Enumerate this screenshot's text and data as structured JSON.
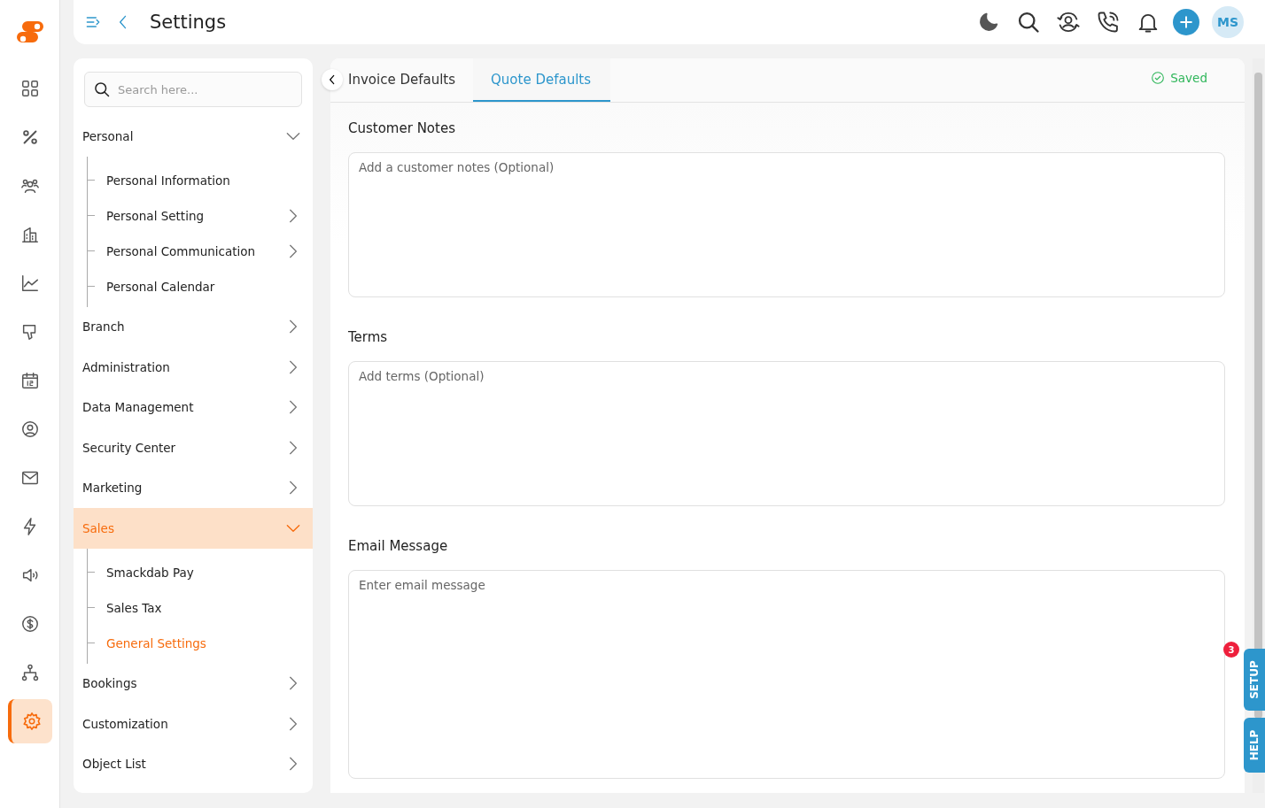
{
  "rail": {
    "items": [
      {
        "selected": false
      },
      {
        "selected": false
      },
      {
        "selected": false
      },
      {
        "selected": false
      },
      {
        "selected": false
      },
      {
        "selected": false
      },
      {
        "selected": false
      },
      {
        "selected": false
      },
      {
        "selected": false
      },
      {
        "selected": false
      },
      {
        "selected": false
      },
      {
        "selected": false
      },
      {
        "selected": false
      },
      {
        "selected": true
      }
    ]
  },
  "header": {
    "title": "Settings",
    "avatar": "MS"
  },
  "sidebar": {
    "search": {
      "placeholder": "Search here..."
    },
    "items": [
      {
        "label": "Personal",
        "expanded": true,
        "selected": false,
        "children": [
          {
            "label": "Personal Information",
            "has_arrow": false,
            "selected": false
          },
          {
            "label": "Personal Setting",
            "has_arrow": true,
            "selected": false
          },
          {
            "label": "Personal Communication",
            "has_arrow": true,
            "selected": false
          },
          {
            "label": "Personal Calendar",
            "has_arrow": false,
            "selected": false
          }
        ]
      },
      {
        "label": "Branch",
        "expanded": false,
        "selected": false
      },
      {
        "label": "Administration",
        "expanded": false,
        "selected": false
      },
      {
        "label": "Data Management",
        "expanded": false,
        "selected": false
      },
      {
        "label": "Security Center",
        "expanded": false,
        "selected": false
      },
      {
        "label": "Marketing",
        "expanded": false,
        "selected": false
      },
      {
        "label": "Sales",
        "expanded": true,
        "selected": true,
        "children": [
          {
            "label": "Smackdab Pay",
            "has_arrow": false,
            "selected": false
          },
          {
            "label": "Sales Tax",
            "has_arrow": false,
            "selected": false
          },
          {
            "label": "General Settings",
            "has_arrow": false,
            "selected": true
          }
        ]
      },
      {
        "label": "Bookings",
        "expanded": false,
        "selected": false
      },
      {
        "label": "Customization",
        "expanded": false,
        "selected": false
      },
      {
        "label": "Object List",
        "expanded": false,
        "selected": false
      }
    ]
  },
  "tabs": [
    {
      "label": "Invoice Defaults",
      "selected": false
    },
    {
      "label": "Quote Defaults",
      "selected": true
    }
  ],
  "save_status": "Saved",
  "fields": [
    {
      "label": "Customer Notes",
      "placeholder": "Add a customer notes (Optional)"
    },
    {
      "label": "Terms",
      "placeholder": "Add terms (Optional)"
    },
    {
      "label": "Email Message",
      "placeholder": "Enter email message"
    }
  ],
  "side_tabs": [
    {
      "label": "SETUP",
      "badge": "3"
    },
    {
      "label": "HELP"
    }
  ]
}
